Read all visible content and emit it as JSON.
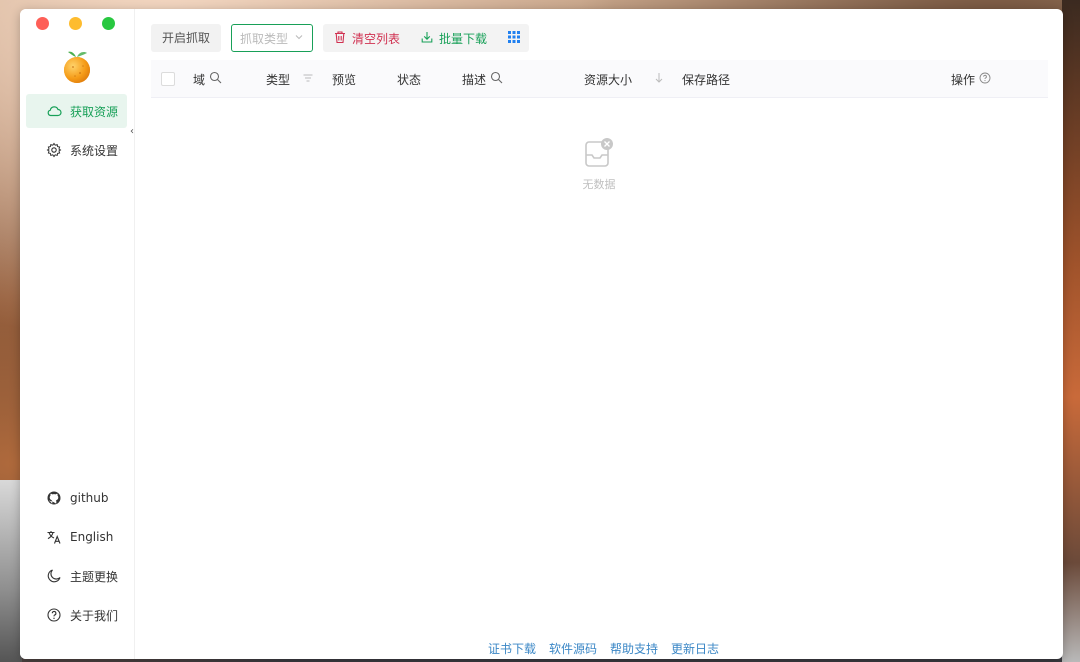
{
  "window": {
    "traffic_lights": {
      "close": "#fe5f57",
      "minimize": "#febc2e",
      "maximize": "#28c840"
    }
  },
  "sidebar": {
    "logo_icon": "orange-fruit-icon",
    "items": [
      {
        "label": "获取资源",
        "icon": "cloud-icon",
        "active": true
      },
      {
        "label": "系统设置",
        "icon": "gear-icon",
        "active": false
      }
    ],
    "bottom_items": [
      {
        "label": "github",
        "icon": "github-icon"
      },
      {
        "label": "English",
        "icon": "translate-icon"
      },
      {
        "label": "主题更换",
        "icon": "moon-icon"
      },
      {
        "label": "关于我们",
        "icon": "help-circle-icon"
      }
    ],
    "collapse_icon": "chevron-left-icon"
  },
  "toolbar": {
    "start_capture": "开启抓取",
    "type_select_placeholder": "抓取类型",
    "clear_list": "清空列表",
    "batch_download": "批量下载",
    "grid_icon": "grid-icon"
  },
  "table": {
    "columns": [
      {
        "label": "域",
        "icon": "search-icon"
      },
      {
        "label": "类型",
        "icon": "filter-icon"
      },
      {
        "label": "预览",
        "icon": ""
      },
      {
        "label": "状态",
        "icon": ""
      },
      {
        "label": "描述",
        "icon": "search-icon"
      },
      {
        "label": "资源大小",
        "icon": "sort-down-icon"
      },
      {
        "label": "保存路径",
        "icon": ""
      },
      {
        "label": "操作",
        "icon": "help-circle-icon"
      }
    ],
    "rows": [],
    "empty_text": "无数据"
  },
  "footer": {
    "links": [
      "证书下载",
      "软件源码",
      "帮助支持",
      "更新日志"
    ]
  },
  "colors": {
    "accent_green": "#18a058",
    "danger_red": "#d03050",
    "link_blue": "#3b87c6",
    "grid_blue": "#2080f0"
  }
}
